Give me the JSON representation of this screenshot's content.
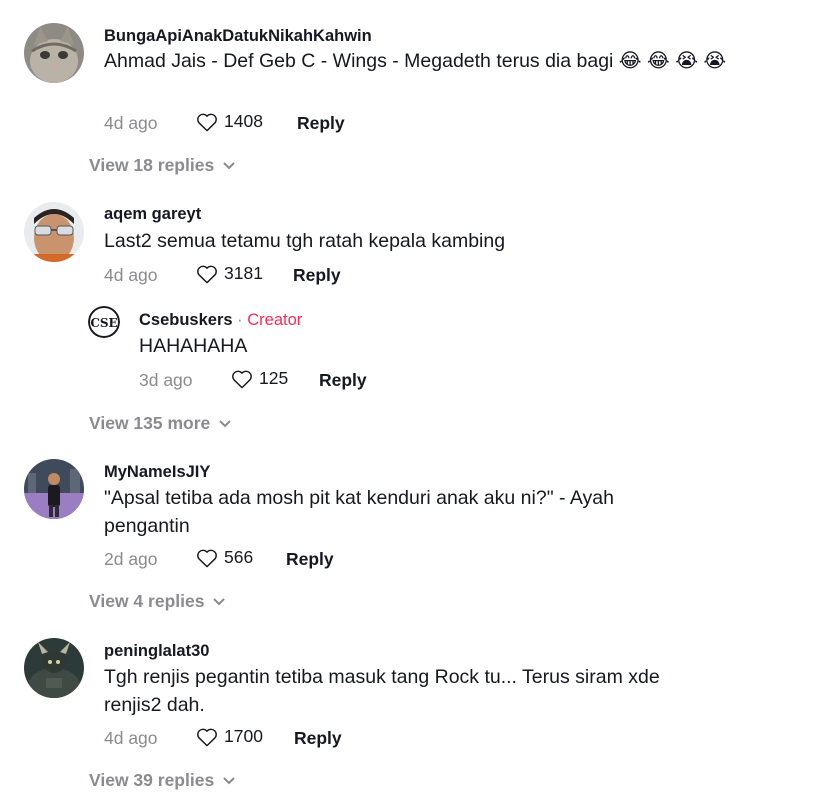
{
  "comments": [
    {
      "username": "BungaApiAnakDatukNikahKahwin",
      "text": "Ahmad Jais - Def Geb C - Wings - Megadeth terus dia bagi 😂 😂 😭 😭",
      "time": "4d ago",
      "likes": "1408",
      "reply_label": "Reply",
      "view_replies": "View 18 replies"
    },
    {
      "username": "aqem gareyt",
      "text": "Last2 semua tetamu tgh ratah kepala kambing",
      "time": "4d ago",
      "likes": "3181",
      "reply_label": "Reply",
      "reply": {
        "username": "Csebuskers",
        "separator": "·",
        "creator_label": "Creator",
        "text": "HAHAHAHA",
        "time": "3d ago",
        "likes": "125",
        "reply_label": "Reply"
      },
      "view_replies": "View 135 more"
    },
    {
      "username": "MyNameIsJIY",
      "text": "\"Apsal tetiba ada mosh pit kat kenduri anak aku ni?\" - Ayah pengantin",
      "time": "2d ago",
      "likes": "566",
      "reply_label": "Reply",
      "view_replies": "View 4 replies"
    },
    {
      "username": "peninglalat30",
      "text": "Tgh renjis pegantin tetiba masuk tang Rock tu... Terus siram xde renjis2 dah.",
      "time": "4d ago",
      "likes": "1700",
      "reply_label": "Reply",
      "view_replies": "View 39 replies"
    }
  ],
  "icons": {
    "like": "heart-outline-icon",
    "expand": "chevron-down-icon"
  },
  "colors": {
    "creator": "#fe2c55",
    "muted": "#8a8b91",
    "text": "#161823"
  }
}
